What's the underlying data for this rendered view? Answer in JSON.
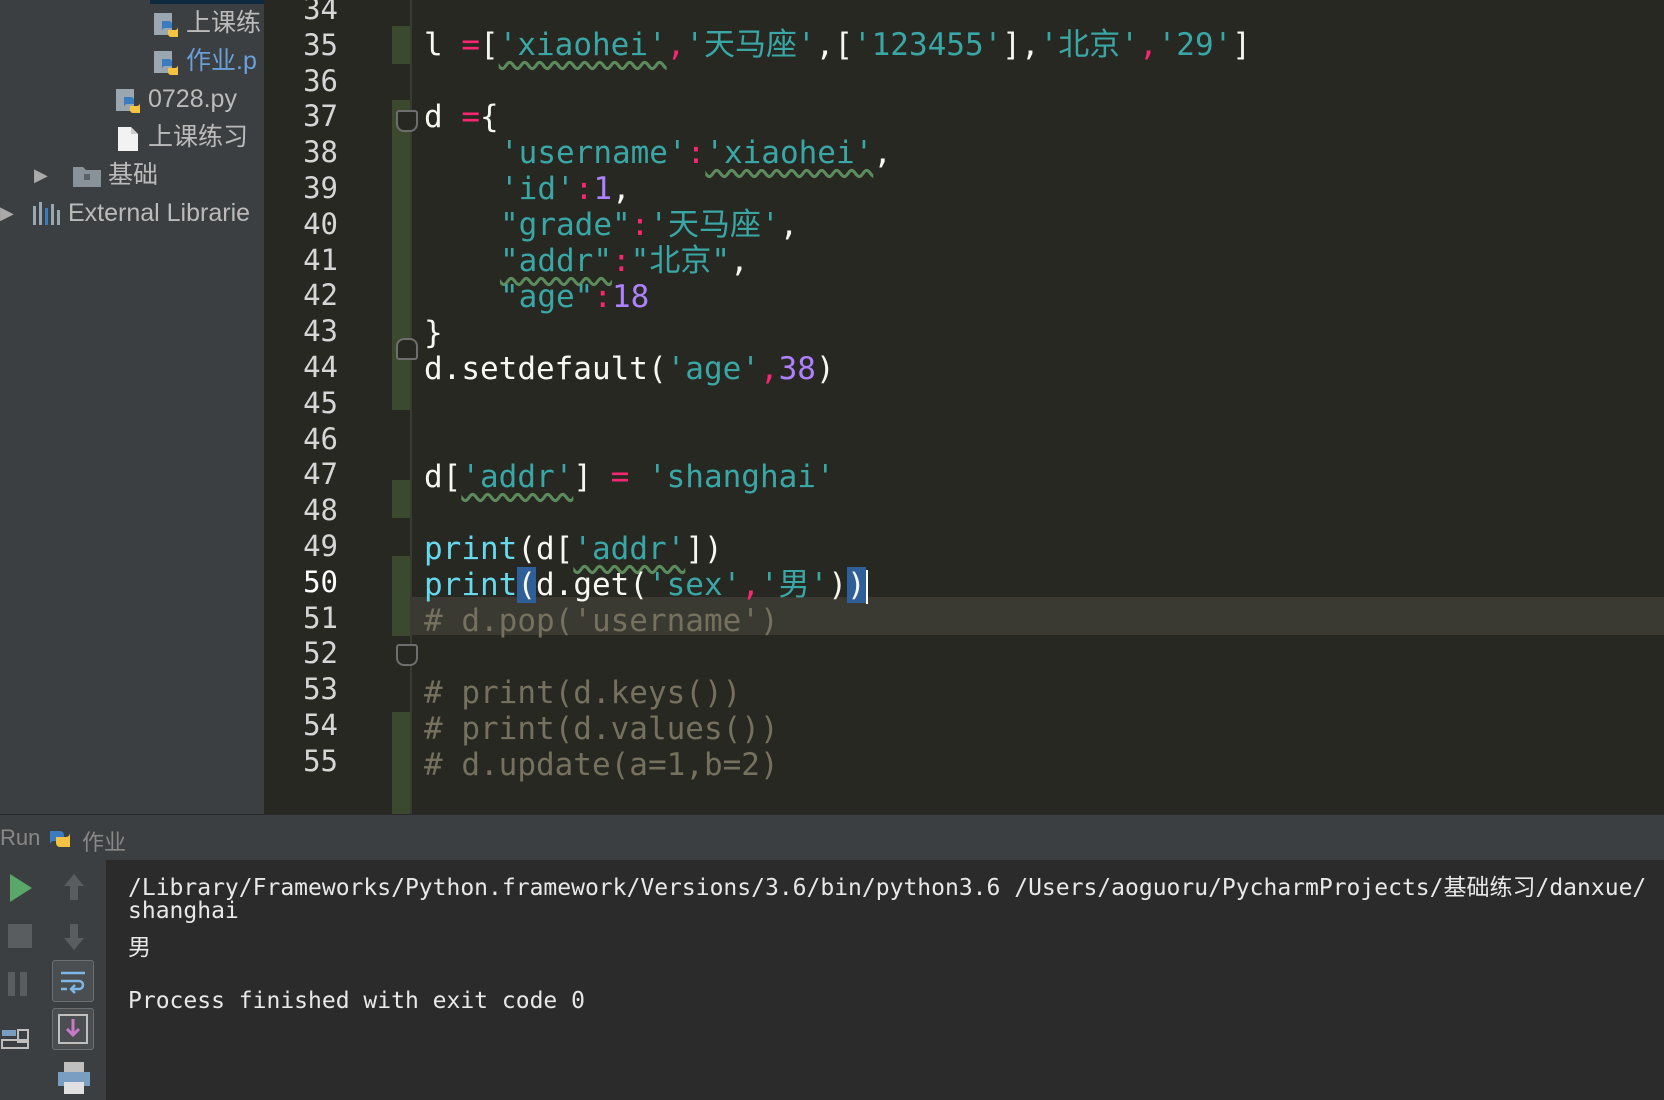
{
  "project_tree": {
    "items": [
      {
        "label": "上课练",
        "icon": "python-file-icon",
        "style": "normal"
      },
      {
        "label": "作业.p",
        "icon": "python-file-icon",
        "style": "blue"
      },
      {
        "label": "0728.py",
        "icon": "python-file-icon",
        "style": "normal"
      },
      {
        "label": "上课练习",
        "icon": "file-icon",
        "style": "normal"
      },
      {
        "label": "基础",
        "icon": "folder-icon",
        "style": "normal"
      },
      {
        "label": "External Librarie",
        "icon": "library-icon",
        "style": "normal"
      }
    ]
  },
  "editor": {
    "current_line": "50",
    "line_numbers": [
      "34",
      "35",
      "36",
      "37",
      "38",
      "39",
      "40",
      "41",
      "42",
      "43",
      "44",
      "45",
      "46",
      "47",
      "48",
      "49",
      "50",
      "51",
      "52",
      "53",
      "54",
      "55"
    ],
    "code": {
      "l35": {
        "a": "l ",
        "b": "=",
        "c": "[",
        "d": "'xiaohei'",
        "e": ",",
        "f": "'天马座'",
        "g": ",[",
        "h": "'123455'",
        "i": "],",
        "j": "'北京'",
        "k": ",",
        "m": "'29'",
        "n": "]"
      },
      "l37": {
        "a": "d ",
        "b": "=",
        "c": "{"
      },
      "l38": {
        "a": "'username'",
        "b": ":",
        "c": "'xiaohei'",
        "d": ","
      },
      "l39": {
        "a": "'id'",
        "b": ":",
        "c": "1",
        "d": ","
      },
      "l40": {
        "a": "\"grade\"",
        "b": ":",
        "c": "'天马座'",
        "d": ","
      },
      "l41": {
        "a": "\"addr\"",
        "b": ":",
        "c": "\"北京\"",
        "d": ","
      },
      "l42": {
        "a": "\"age\"",
        "b": ":",
        "c": "18"
      },
      "l43": {
        "a": "}"
      },
      "l44": {
        "a": "d.setdefault(",
        "b": "'age'",
        "c": ",",
        "d": "38",
        "e": ")"
      },
      "l47": {
        "a": "d[",
        "b": "'addr'",
        "c": "] ",
        "d": "=",
        "e": " ",
        "f": "'shanghai'"
      },
      "l49": {
        "a": "print",
        "b": "(d[",
        "c": "'addr'",
        "d": "])"
      },
      "l50": {
        "a": "print",
        "b": "(",
        "c": "d.get(",
        "d": "'sex'",
        "e": ",",
        "f": "'男'",
        "g": ")",
        "h": ")"
      },
      "l51": {
        "a": "# d.pop('username')"
      },
      "l53": {
        "a": "# print(d.keys())"
      },
      "l54": {
        "a": "# print(d.values())"
      },
      "l55": {
        "a": "# d.update(a=1,b=2)"
      }
    }
  },
  "run_panel": {
    "title": "Run",
    "config_name": "作业",
    "output": [
      "/Library/Frameworks/Python.framework/Versions/3.6/bin/python3.6 /Users/aoguoru/PycharmProjects/基础练习/danxue/",
      "shanghai",
      "男",
      "",
      "Process finished with exit code 0"
    ],
    "toolbar": [
      "run-icon",
      "stop-icon",
      "pause-icon",
      "layout-icon",
      "up-icon",
      "down-icon",
      "soft-wrap-icon",
      "scroll-to-end-icon",
      "print-icon"
    ]
  },
  "colors": {
    "keyword": "#66d9ef",
    "string": "#3aa7a7",
    "operator": "#f92672",
    "number": "#ae81ff",
    "comment": "#75715e",
    "editor_bg": "#272822"
  }
}
